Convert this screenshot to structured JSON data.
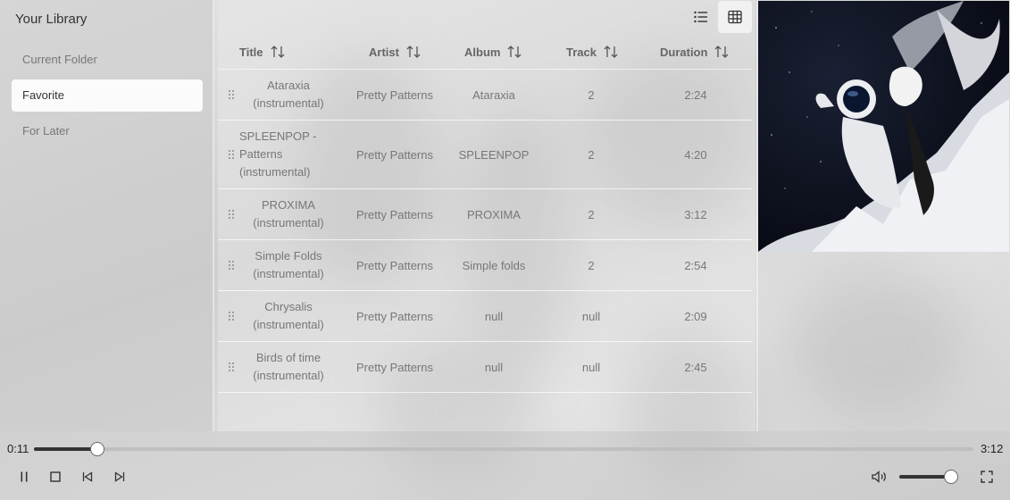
{
  "sidebar": {
    "title": "Your Library",
    "items": [
      {
        "label": "Current Folder",
        "active": false
      },
      {
        "label": "Favorite",
        "active": true
      },
      {
        "label": "For Later",
        "active": false
      }
    ]
  },
  "toolbar": {
    "list_view_icon": "list-icon",
    "table_view_icon": "table-icon",
    "active_view": "table"
  },
  "table": {
    "columns": [
      "Title",
      "Artist",
      "Album",
      "Track",
      "Duration"
    ],
    "rows": [
      {
        "title": "Ataraxia (instrumental)",
        "artist": "Pretty Patterns",
        "album": "Ataraxia",
        "track": "2",
        "duration": "2:24"
      },
      {
        "title": "SPLEENPOP - Patterns (instrumental)",
        "artist": "Pretty Patterns",
        "album": "SPLEENPOP",
        "track": "2",
        "duration": "4:20"
      },
      {
        "title": "PROXIMA (instrumental)",
        "artist": "Pretty Patterns",
        "album": "PROXIMA",
        "track": "2",
        "duration": "3:12"
      },
      {
        "title": "Simple Folds (instrumental)",
        "artist": "Pretty Patterns",
        "album": "Simple folds",
        "track": "2",
        "duration": "2:54"
      },
      {
        "title": "Chrysalis (instrumental)",
        "artist": "Pretty Patterns",
        "album": "null",
        "track": "null",
        "duration": "2:09"
      },
      {
        "title": "Birds of time (instrumental)",
        "artist": "Pretty Patterns",
        "album": "null",
        "track": "null",
        "duration": "2:45"
      }
    ]
  },
  "player": {
    "elapsed": "0:11",
    "total": "3:12",
    "progress": 0.0675,
    "volume": 0.9,
    "state": "playing"
  },
  "colors": {
    "accent": "#333333",
    "track": "#bfbfbf"
  }
}
